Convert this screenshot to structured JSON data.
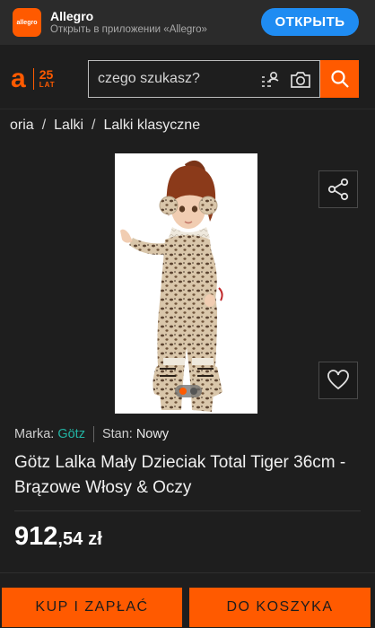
{
  "app_banner": {
    "icon_text": "allegro",
    "app_name": "Allegro",
    "subtitle": "Открыть в приложении «Allegro»",
    "open_label": "ОТКРЫТЬ"
  },
  "logo": {
    "letter": "a",
    "number": "25",
    "word": "LAT"
  },
  "search": {
    "placeholder": "czego szukasz?",
    "icons": [
      "list-person-icon",
      "camera-icon",
      "search-icon"
    ]
  },
  "breadcrumb": [
    "oria",
    "Lalki",
    "Lalki klasyczne"
  ],
  "gallery": {
    "image": "doll-photo",
    "slides": 2,
    "active_slide": 1
  },
  "product": {
    "brand_label": "Marka:",
    "brand_value": "Götz",
    "condition_label": "Stan:",
    "condition_value": "Nowy",
    "title": "Götz Lalka Mały Dzieciak Total Tiger 36cm - Brązowe Włosy & Oczy",
    "price_int": "912",
    "price_dec": ",54",
    "currency": "zł"
  },
  "actions": {
    "buy_label": "KUP I ZAPŁAĆ",
    "cart_label": "DO KOSZYKA"
  },
  "colors": {
    "accent": "#ff5a00",
    "banner_button": "#1f8cf2",
    "brand_link": "#22b3a3",
    "background": "#1e1e1e"
  }
}
